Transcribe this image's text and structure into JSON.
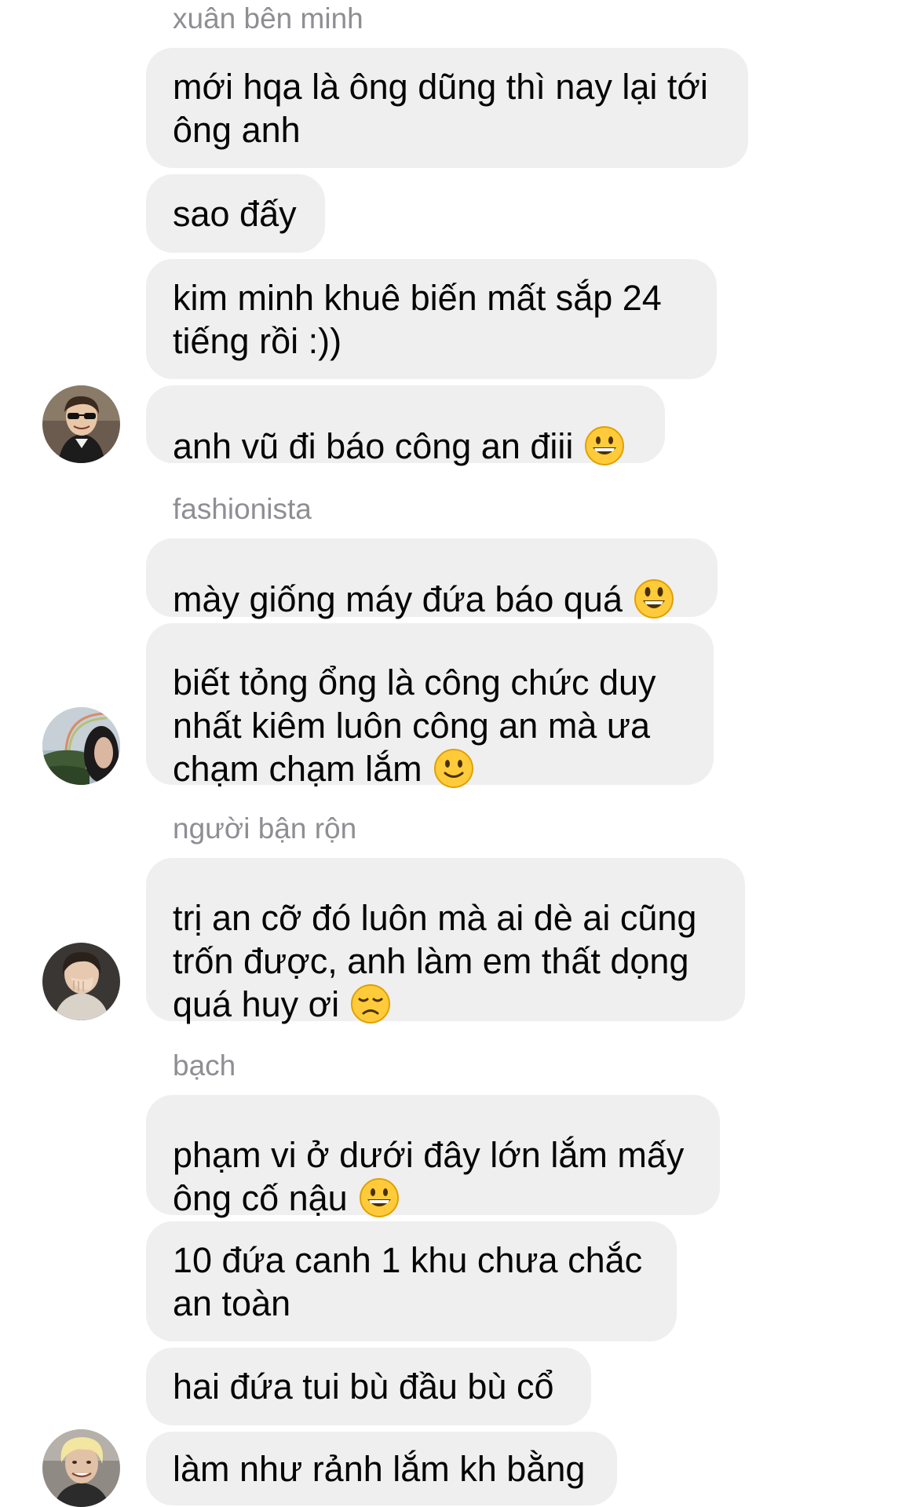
{
  "groups": [
    {
      "sender": "xuân bên minh",
      "avatar_icon": "avatar-man-sunglasses",
      "messages": [
        {
          "text": "mới hqa là ông dũng thì nay lại tới\nông anh"
        },
        {
          "text": "sao đấy"
        },
        {
          "text": "kim minh khuê biến mất sắp 24\ntiếng rồi :))"
        },
        {
          "text": "anh vũ đi báo công an điii",
          "emoji": "grinning-face"
        }
      ]
    },
    {
      "sender": "fashionista",
      "avatar_icon": "avatar-rainbow-landscape",
      "messages": [
        {
          "text": "mày giống máy đứa báo quá",
          "emoji": "smiley-face"
        },
        {
          "text": "biết tỏng ổng là công chức duy\nnhất kiêm luôn công an mà ưa\nchạm chạm lắm",
          "emoji": "slightly-smiling-face"
        }
      ]
    },
    {
      "sender": "người bận rộn",
      "avatar_icon": "avatar-person-hand-face",
      "messages": [
        {
          "text": "trị an cỡ đó luôn mà ai dè ai cũng\ntrốn được, anh làm em thất dọng\nquá huy ơi",
          "emoji": "disappointed-face"
        }
      ]
    },
    {
      "sender": "bạch",
      "avatar_icon": "avatar-blond-person",
      "messages": [
        {
          "text": "phạm vi ở dưới đây lớn lắm mấy\nông cố nậu",
          "emoji": "grinning-face"
        },
        {
          "text": "10 đứa canh 1 khu chưa chắc\nan toàn"
        },
        {
          "text": "hai đứa tui bù đầu bù cổ"
        },
        {
          "text": "làm như rảnh lắm kh bằng"
        }
      ]
    }
  ],
  "colors": {
    "bubble_bg": "#efeff0",
    "message_text": "#050505",
    "sender_name": "#8e8e93",
    "emoji_yellow": "#ffcb3a",
    "emoji_outline": "#e2a000"
  }
}
